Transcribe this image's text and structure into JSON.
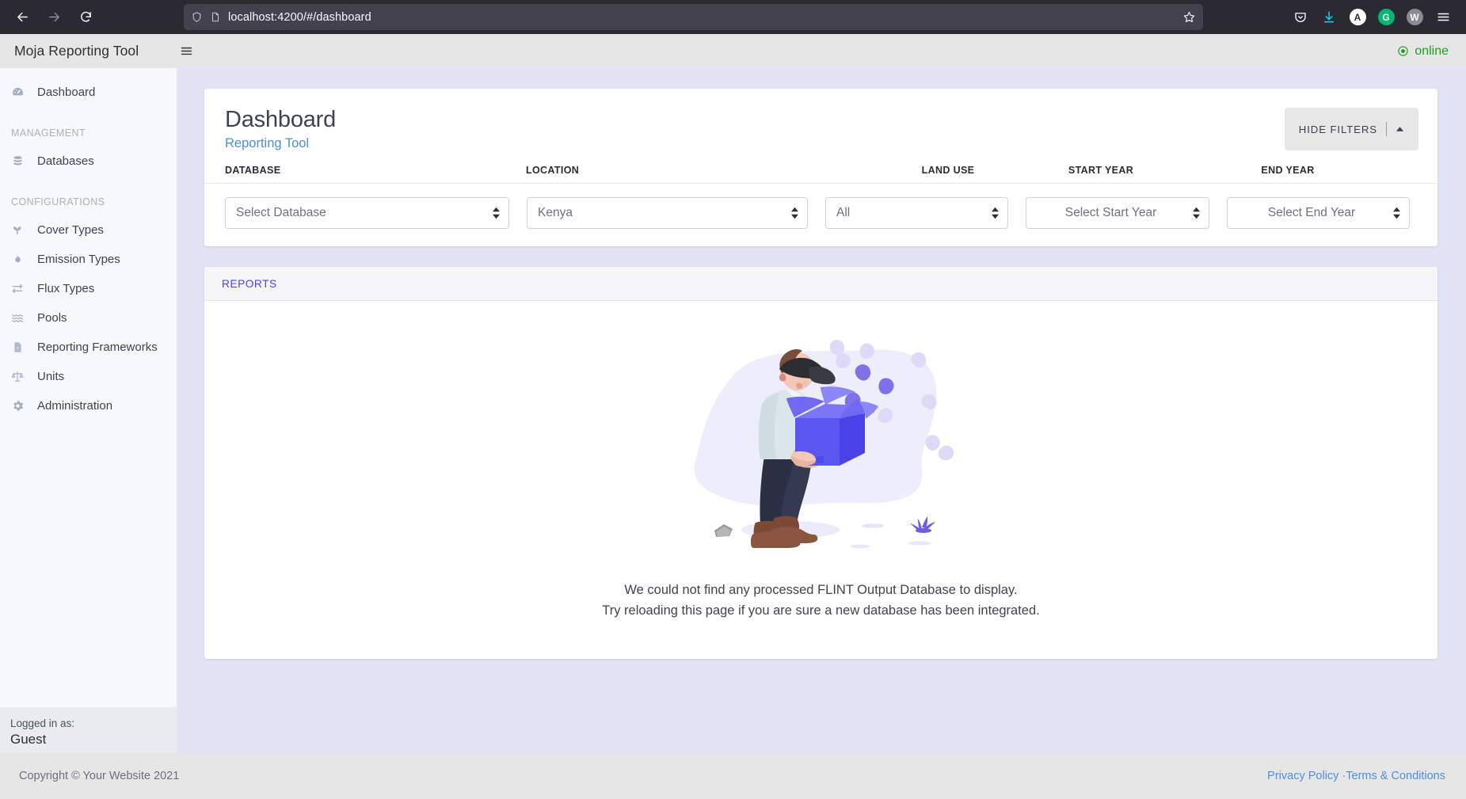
{
  "browser": {
    "back_icon": "back-arrow-icon",
    "forward_icon": "forward-arrow-icon",
    "reload_icon": "reload-icon",
    "shield_icon": "shield-icon",
    "page_icon": "page-document-icon",
    "url": "localhost:4200/#/dashboard",
    "bookmark_icon": "star-icon",
    "toolbar_icons": [
      "pocket-icon",
      "download-icon",
      "hamburger-menu-icon"
    ],
    "avatars": [
      {
        "name": "account-avatar-a",
        "letter": "A"
      },
      {
        "name": "extension-avatar-g",
        "letter": "G"
      },
      {
        "name": "extension-avatar-w",
        "letter": "W"
      }
    ]
  },
  "header": {
    "brand": "Moja Reporting Tool",
    "menu_icon": "hamburger-menu-icon",
    "status_icon": "circle-dot-icon",
    "status_label": "online",
    "status_color": "#1e9e1e"
  },
  "sidebar": {
    "items": [
      {
        "label": "Dashboard",
        "icon": "tachometer-icon",
        "name": "dashboard"
      }
    ],
    "sections": [
      {
        "title": "MANAGEMENT",
        "items": [
          {
            "label": "Databases",
            "icon": "database-icon",
            "name": "databases"
          }
        ]
      },
      {
        "title": "CONFIGURATIONS",
        "items": [
          {
            "label": "Cover Types",
            "icon": "seedling-icon",
            "name": "cover-types"
          },
          {
            "label": "Emission Types",
            "icon": "flame-icon",
            "name": "emission-types"
          },
          {
            "label": "Flux Types",
            "icon": "exchange-arrows-icon",
            "name": "flux-types"
          },
          {
            "label": "Pools",
            "icon": "water-layers-icon",
            "name": "pools"
          },
          {
            "label": "Reporting Frameworks",
            "icon": "file-spreadsheet-icon",
            "name": "reporting-frameworks"
          },
          {
            "label": "Units",
            "icon": "balance-scale-icon",
            "name": "units"
          },
          {
            "label": "Administration",
            "icon": "gear-icon",
            "name": "administration"
          }
        ]
      }
    ],
    "logged_in_label": "Logged in as:",
    "user_name": "Guest"
  },
  "page": {
    "title": "Dashboard",
    "subtitle": "Reporting Tool",
    "hide_filters_label": "HIDE FILTERS",
    "caret_icon": "caret-up-icon"
  },
  "filters": [
    {
      "name": "database",
      "label": "DATABASE",
      "value": "Select Database",
      "is_placeholder": true
    },
    {
      "name": "location",
      "label": "LOCATION",
      "value": "Kenya",
      "is_placeholder": false
    },
    {
      "name": "land-use",
      "label": "LAND USE",
      "value": "All",
      "is_placeholder": false
    },
    {
      "name": "start-year",
      "label": "START YEAR",
      "value": "Select Start Year",
      "is_placeholder": true
    },
    {
      "name": "end-year",
      "label": "END YEAR",
      "value": "Select End Year",
      "is_placeholder": true
    }
  ],
  "reports": {
    "section_title": "REPORTS",
    "illustration": "person-holding-empty-box-illustration",
    "empty_line1": "We could not find any processed FLINT Output Database to display.",
    "empty_line2": "Try reloading this page if you are sure a new database has been integrated."
  },
  "footer": {
    "copyright": "Copyright © Your Website 2021",
    "privacy_label": "Privacy Policy",
    "separator": " ·",
    "terms_label": "Terms & Conditions"
  },
  "colors": {
    "accent_blue": "#4a90d9",
    "reports_blue": "#4b43f0",
    "online_green": "#1e9e1e",
    "main_bg": "#e3e3f6"
  }
}
